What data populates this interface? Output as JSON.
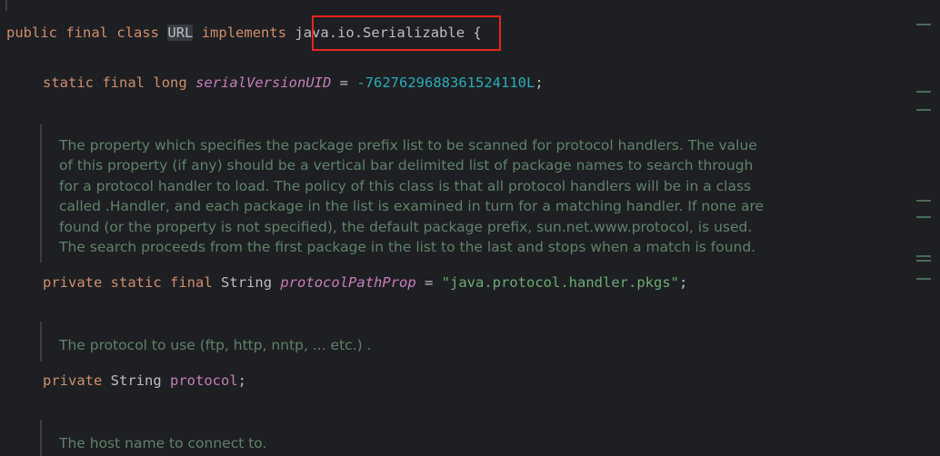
{
  "code": {
    "class_decl": {
      "kw_public": "public",
      "kw_final": "final",
      "kw_class": "class",
      "class_name": "URL",
      "kw_implements": "implements",
      "interface": "java.io.Serializable",
      "brace": " {"
    },
    "serial": {
      "kw_static": "static",
      "kw_final": "final",
      "kw_long": "long",
      "name": "serialVersionUID",
      "eq": " = ",
      "value": "-7627629688361524110L",
      "semi": ";"
    },
    "doc1": "The property which specifies the package prefix list to be scanned for protocol handlers. The value of this property (if any) should be a vertical bar delimited list of package names to search through for a protocol handler to load. The policy of this class is that all protocol handlers will be in a class called .Handler, and each package in the list is examined in turn for a matching handler. If none are found (or the property is not specified), the default package prefix, sun.net.www.protocol, is used. The search proceeds from the first package in the list to the last and stops when a match is found.",
    "prop": {
      "kw_private": "private",
      "kw_static": "static",
      "kw_final": "final",
      "type": "String",
      "name": "protocolPathProp",
      "eq": " = ",
      "value": "\"java.protocol.handler.pkgs\"",
      "semi": ";"
    },
    "doc2": "The protocol to use (ftp, http, nntp, ... etc.) .",
    "protocol": {
      "kw_private": "private",
      "type": "String",
      "name": "protocol",
      "semi": ";"
    },
    "doc3": "The host name to connect to."
  }
}
